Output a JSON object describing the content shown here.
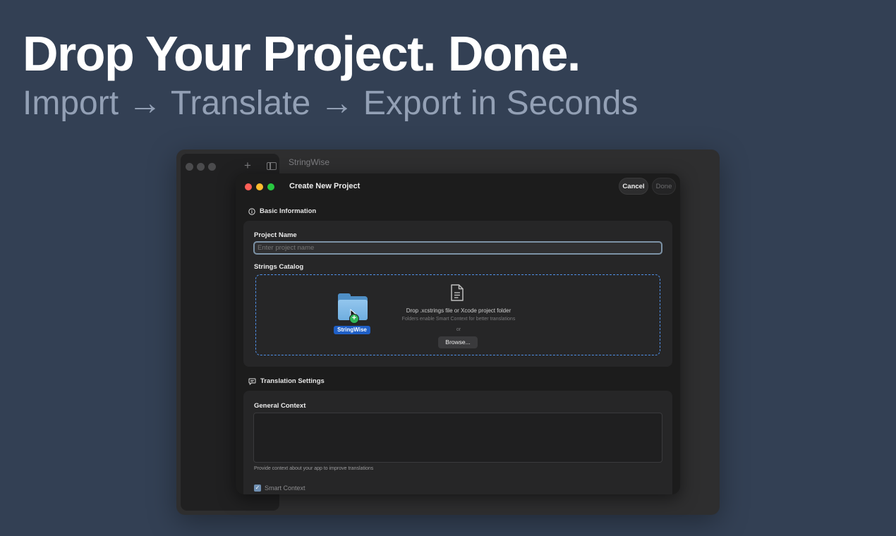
{
  "hero": {
    "title": "Drop Your Project. Done.",
    "subtitle": "Import → Translate → Export in Seconds"
  },
  "app": {
    "title": "StringWise",
    "sidebar_add_icon": "plus-icon",
    "sidebar_toggle_icon": "sidebar-toggle-icon"
  },
  "dialog": {
    "title": "Create New Project",
    "cancel_label": "Cancel",
    "done_label": "Done",
    "basic_info": {
      "heading": "Basic Information",
      "icon": "info-circle-icon",
      "project_name_label": "Project Name",
      "project_name_placeholder": "Enter project name",
      "project_name_value": "",
      "strings_catalog_label": "Strings Catalog",
      "drop_main": "Drop .xcstrings file or Xcode project folder",
      "drop_sub": "Folders enable Smart Context for better translations",
      "drop_or": "or",
      "browse_label": "Browse...",
      "dragged_folder_name": "StringWise",
      "document_icon": "document-icon",
      "folder_icon": "folder-icon"
    },
    "translation": {
      "heading": "Translation Settings",
      "icon": "speech-bubble-icon",
      "general_context_label": "General Context",
      "general_context_value": "",
      "helper": "Provide context about your app to improve translations",
      "smart_context_label": "Smart Context",
      "smart_context_checked": true
    }
  },
  "colors": {
    "background": "#334054",
    "accent_blue": "#4f8fe6",
    "traffic_red": "#fe5f57",
    "traffic_yellow": "#febc2e",
    "traffic_green": "#28c840"
  }
}
